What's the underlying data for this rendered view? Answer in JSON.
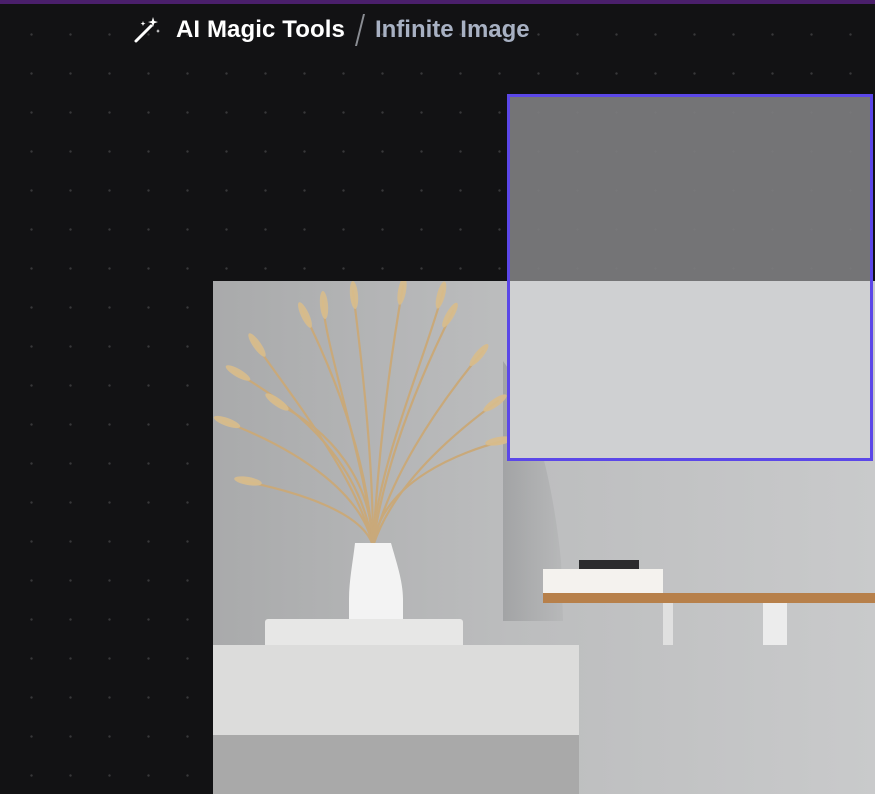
{
  "breadcrumb": {
    "app_title": "AI Magic Tools",
    "current_page": "Infinite Image"
  },
  "icons": {
    "wand": "magic-wand-icon"
  },
  "colors": {
    "background": "#121214",
    "accent_bar": "#4a1f6b",
    "selection_border": "#5b47e8",
    "breadcrumb_current": "#a8b1c3"
  }
}
